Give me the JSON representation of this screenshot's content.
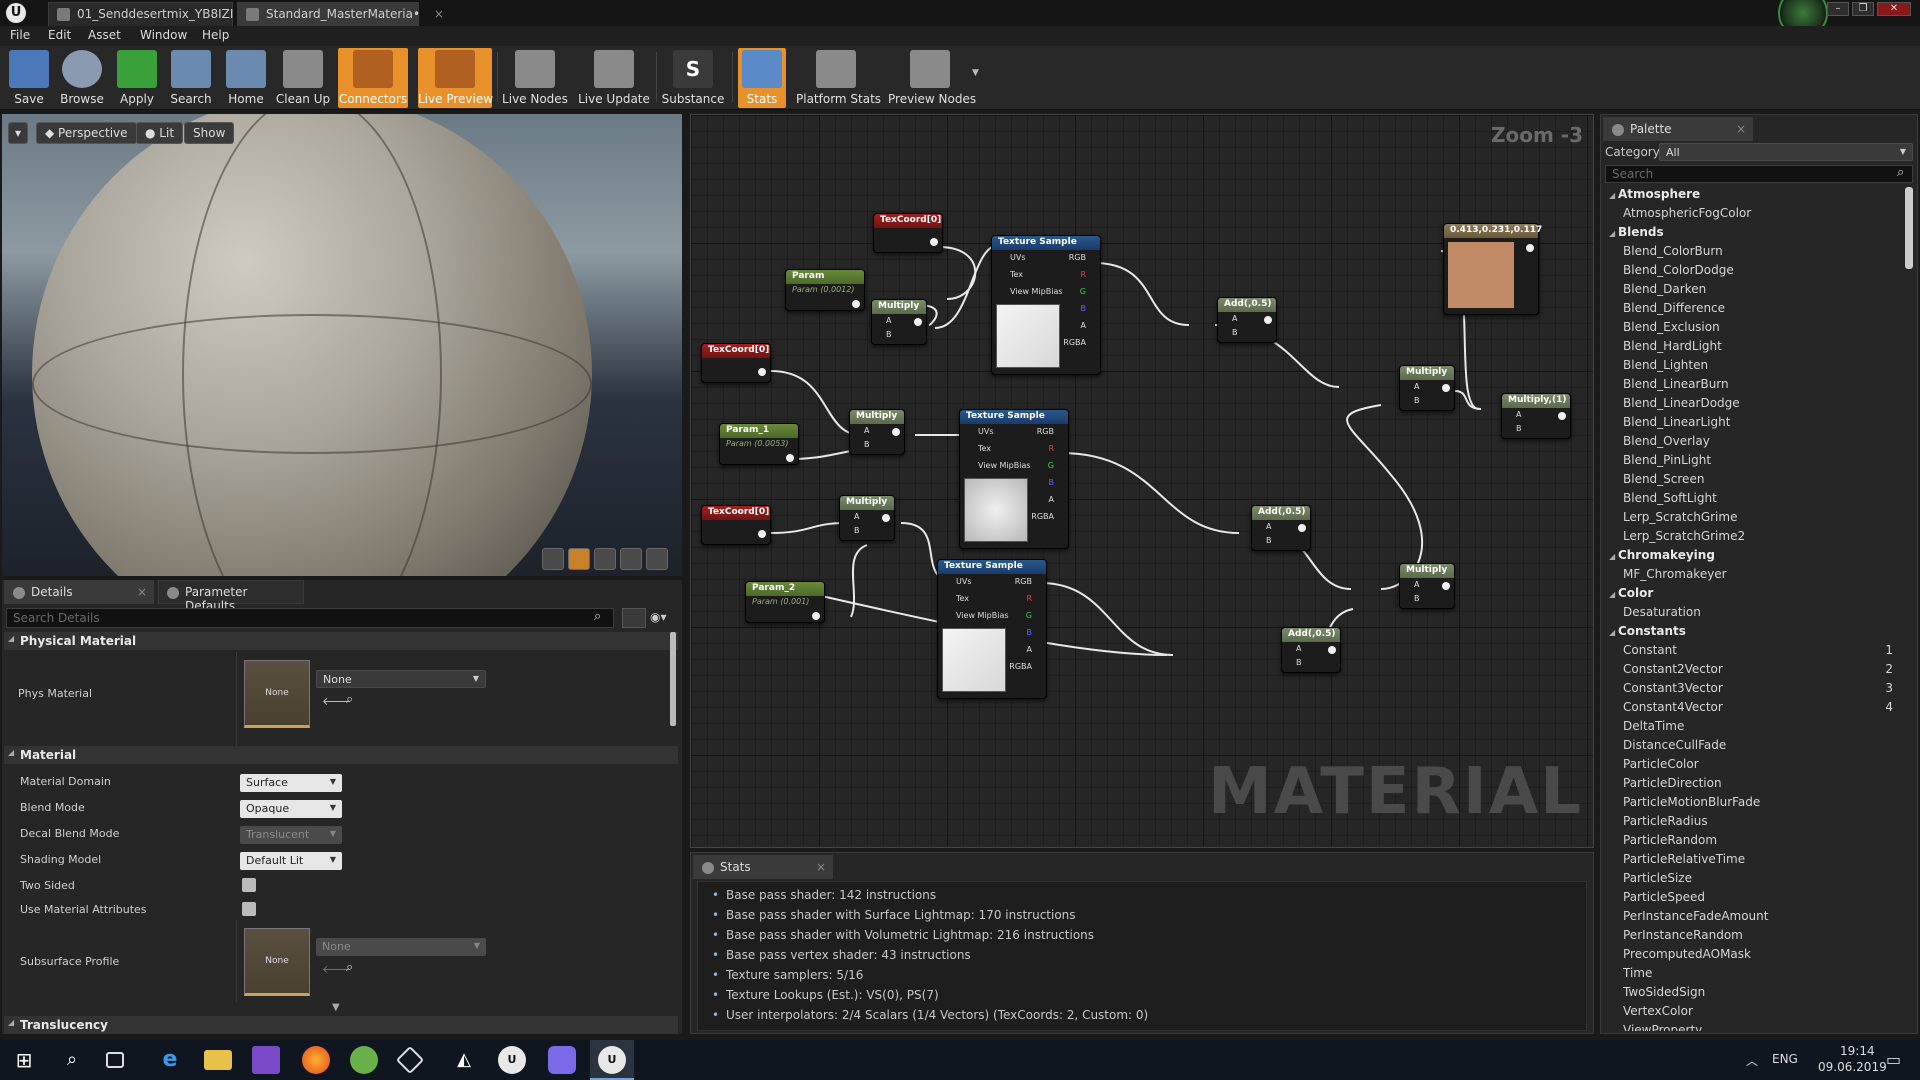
{
  "titlebar": {
    "logo": "U",
    "tabs": [
      {
        "label": "01_Senddesertmix_YB8IZI"
      },
      {
        "label": "Standard_MasterMateria•"
      }
    ],
    "window_controls": [
      "–",
      "❐",
      "✕"
    ]
  },
  "menubar": {
    "items": [
      "File",
      "Edit",
      "Asset",
      "Window",
      "Help"
    ]
  },
  "toolbar": {
    "buttons": [
      {
        "label": "Save",
        "icon": "save-icon",
        "color": "#4a78b8"
      },
      {
        "label": "Browse",
        "icon": "browse-icon",
        "color": "#8a9ab0"
      },
      {
        "label": "Apply",
        "icon": "apply-icon",
        "color": "#3aa03a"
      },
      {
        "label": "Search",
        "icon": "search-icon",
        "color": "#6a8ab0"
      },
      {
        "label": "Home",
        "icon": "home-icon",
        "color": "#6a8ab0"
      },
      {
        "label": "Clean Up",
        "icon": "clean-up-icon",
        "color": "#8a8a8a"
      },
      {
        "label": "Connectors",
        "icon": "connectors-icon",
        "color": "#b06020"
      },
      {
        "label": "Live Preview",
        "icon": "live-preview-icon",
        "color": "#b06020"
      },
      {
        "label": "Live Nodes",
        "icon": "live-nodes-icon",
        "color": "#8a8a8a"
      },
      {
        "label": "Live Update",
        "icon": "live-update-icon",
        "color": "#8a8a8a"
      },
      {
        "label": "Substance",
        "icon": "substance-icon",
        "color": "#3a3a3a"
      },
      {
        "label": "Stats",
        "icon": "stats-icon",
        "color": "#5a8ac8"
      },
      {
        "label": "Platform Stats",
        "icon": "platform-stats-icon",
        "color": "#8a8a8a"
      },
      {
        "label": "Preview Nodes",
        "icon": "preview-nodes-icon",
        "color": "#8a8a8a"
      }
    ],
    "active": [
      "Connectors",
      "Live Preview",
      "Stats"
    ]
  },
  "viewport": {
    "perspective": "Perspective",
    "lit": "Lit",
    "show": "Show"
  },
  "details": {
    "tabs": [
      "Details",
      "Parameter Defaults"
    ],
    "search_placeholder": "Search Details",
    "sections": {
      "physical_material": "Physical Material",
      "material": "Material",
      "translucency": "Translucency"
    },
    "phys_material": {
      "label": "Phys Material",
      "value": "None",
      "thumb": "None"
    },
    "material_domain": {
      "label": "Material Domain",
      "value": "Surface"
    },
    "blend_mode": {
      "label": "Blend Mode",
      "value": "Opaque"
    },
    "decal_blend_mode": {
      "label": "Decal Blend Mode",
      "value": "Translucent"
    },
    "shading_model": {
      "label": "Shading Model",
      "value": "Default Lit"
    },
    "two_sided": {
      "label": "Two Sided",
      "checked": false
    },
    "use_material_attributes": {
      "label": "Use Material Attributes",
      "checked": false
    },
    "subsurface_profile": {
      "label": "Subsurface Profile",
      "value": "None",
      "thumb": "None"
    }
  },
  "graph": {
    "zoom": "Zoom -3",
    "watermark": "MATERIAL",
    "nodes": {
      "texcoord1": "TexCoord[0]",
      "texcoord2": "TexCoord[0]",
      "texcoord3": "TexCoord[0]",
      "param": {
        "title": "Param",
        "sub": "Param (0.0012)"
      },
      "param1": {
        "title": "Param_1",
        "sub": "Param (0.0053)"
      },
      "param2": {
        "title": "Param_2",
        "sub": "Param (0.001)"
      },
      "multiply1": "Multiply",
      "multiply2": "Multiply",
      "multiply3": "Multiply",
      "multiply4": "Multiply",
      "multiply5": "Multiply",
      "multiply6": "Multiply,(1)",
      "texsample1": "Texture Sample",
      "texsample2": "Texture Sample",
      "texsample3": "Texture Sample",
      "add1": "Add(,0.5)",
      "add2": "Add(,0.5)",
      "add3": "Add(,0.5)",
      "color": {
        "title": "0.413,0.231,0.117",
        "hex": "#c08a66"
      }
    },
    "pins": {
      "uvs": "UVs",
      "tex": "Tex",
      "mip": "View MipBias",
      "rgb": "RGB",
      "r": "R",
      "g": "G",
      "b": "B",
      "a": "A",
      "rgba": "RGBA",
      "pa": "A",
      "pb": "B"
    }
  },
  "stats": {
    "tab": "Stats",
    "lines": [
      "Base pass shader: 142 instructions",
      "Base pass shader with Surface Lightmap: 170 instructions",
      "Base pass shader with Volumetric Lightmap: 216 instructions",
      "Base pass vertex shader: 43 instructions",
      "Texture samplers: 5/16",
      "Texture Lookups (Est.): VS(0), PS(7)",
      "User interpolators: 2/4 Scalars (1/4 Vectors) (TexCoords: 2, Custom: 0)"
    ]
  },
  "palette": {
    "tab": "Palette",
    "category_label": "Category:",
    "category_value": "All",
    "search_placeholder": "Search",
    "entries": [
      {
        "type": "cat",
        "text": "Atmosphere"
      },
      {
        "type": "item",
        "text": "AtmosphericFogColor"
      },
      {
        "type": "cat",
        "text": "Blends"
      },
      {
        "type": "item",
        "text": "Blend_ColorBurn"
      },
      {
        "type": "item",
        "text": "Blend_ColorDodge"
      },
      {
        "type": "item",
        "text": "Blend_Darken"
      },
      {
        "type": "item",
        "text": "Blend_Difference"
      },
      {
        "type": "item",
        "text": "Blend_Exclusion"
      },
      {
        "type": "item",
        "text": "Blend_HardLight"
      },
      {
        "type": "item",
        "text": "Blend_Lighten"
      },
      {
        "type": "item",
        "text": "Blend_LinearBurn"
      },
      {
        "type": "item",
        "text": "Blend_LinearDodge"
      },
      {
        "type": "item",
        "text": "Blend_LinearLight"
      },
      {
        "type": "item",
        "text": "Blend_Overlay"
      },
      {
        "type": "item",
        "text": "Blend_PinLight"
      },
      {
        "type": "item",
        "text": "Blend_Screen"
      },
      {
        "type": "item",
        "text": "Blend_SoftLight"
      },
      {
        "type": "item",
        "text": "Lerp_ScratchGrime"
      },
      {
        "type": "item",
        "text": "Lerp_ScratchGrime2"
      },
      {
        "type": "cat",
        "text": "Chromakeying"
      },
      {
        "type": "item",
        "text": "MF_Chromakeyer"
      },
      {
        "type": "cat",
        "text": "Color"
      },
      {
        "type": "item",
        "text": "Desaturation"
      },
      {
        "type": "cat",
        "text": "Constants"
      },
      {
        "type": "item",
        "text": "Constant",
        "num": "1"
      },
      {
        "type": "item",
        "text": "Constant2Vector",
        "num": "2"
      },
      {
        "type": "item",
        "text": "Constant3Vector",
        "num": "3"
      },
      {
        "type": "item",
        "text": "Constant4Vector",
        "num": "4"
      },
      {
        "type": "item",
        "text": "DeltaTime"
      },
      {
        "type": "item",
        "text": "DistanceCullFade"
      },
      {
        "type": "item",
        "text": "ParticleColor"
      },
      {
        "type": "item",
        "text": "ParticleDirection"
      },
      {
        "type": "item",
        "text": "ParticleMotionBlurFade"
      },
      {
        "type": "item",
        "text": "ParticleRadius"
      },
      {
        "type": "item",
        "text": "ParticleRandom"
      },
      {
        "type": "item",
        "text": "ParticleRelativeTime"
      },
      {
        "type": "item",
        "text": "ParticleSize"
      },
      {
        "type": "item",
        "text": "ParticleSpeed"
      },
      {
        "type": "item",
        "text": "PerInstanceFadeAmount"
      },
      {
        "type": "item",
        "text": "PerInstanceRandom"
      },
      {
        "type": "item",
        "text": "PrecomputedAOMask"
      },
      {
        "type": "item",
        "text": "Time"
      },
      {
        "type": "item",
        "text": "TwoSidedSign"
      },
      {
        "type": "item",
        "text": "VertexColor"
      },
      {
        "type": "item",
        "text": "ViewProperty"
      }
    ]
  },
  "taskbar": {
    "apps": [
      "windows-start-icon",
      "search-icon",
      "task-view-icon",
      "edge-icon",
      "file-explorer-icon",
      "visual-studio-icon",
      "firefox-icon",
      "app-icon",
      "cube-app-icon",
      "unity-icon",
      "unreal-icon",
      "discord-icon",
      "unreal-active-icon"
    ],
    "lang": "ENG",
    "time": "19:14",
    "date": "09.06.2019"
  }
}
